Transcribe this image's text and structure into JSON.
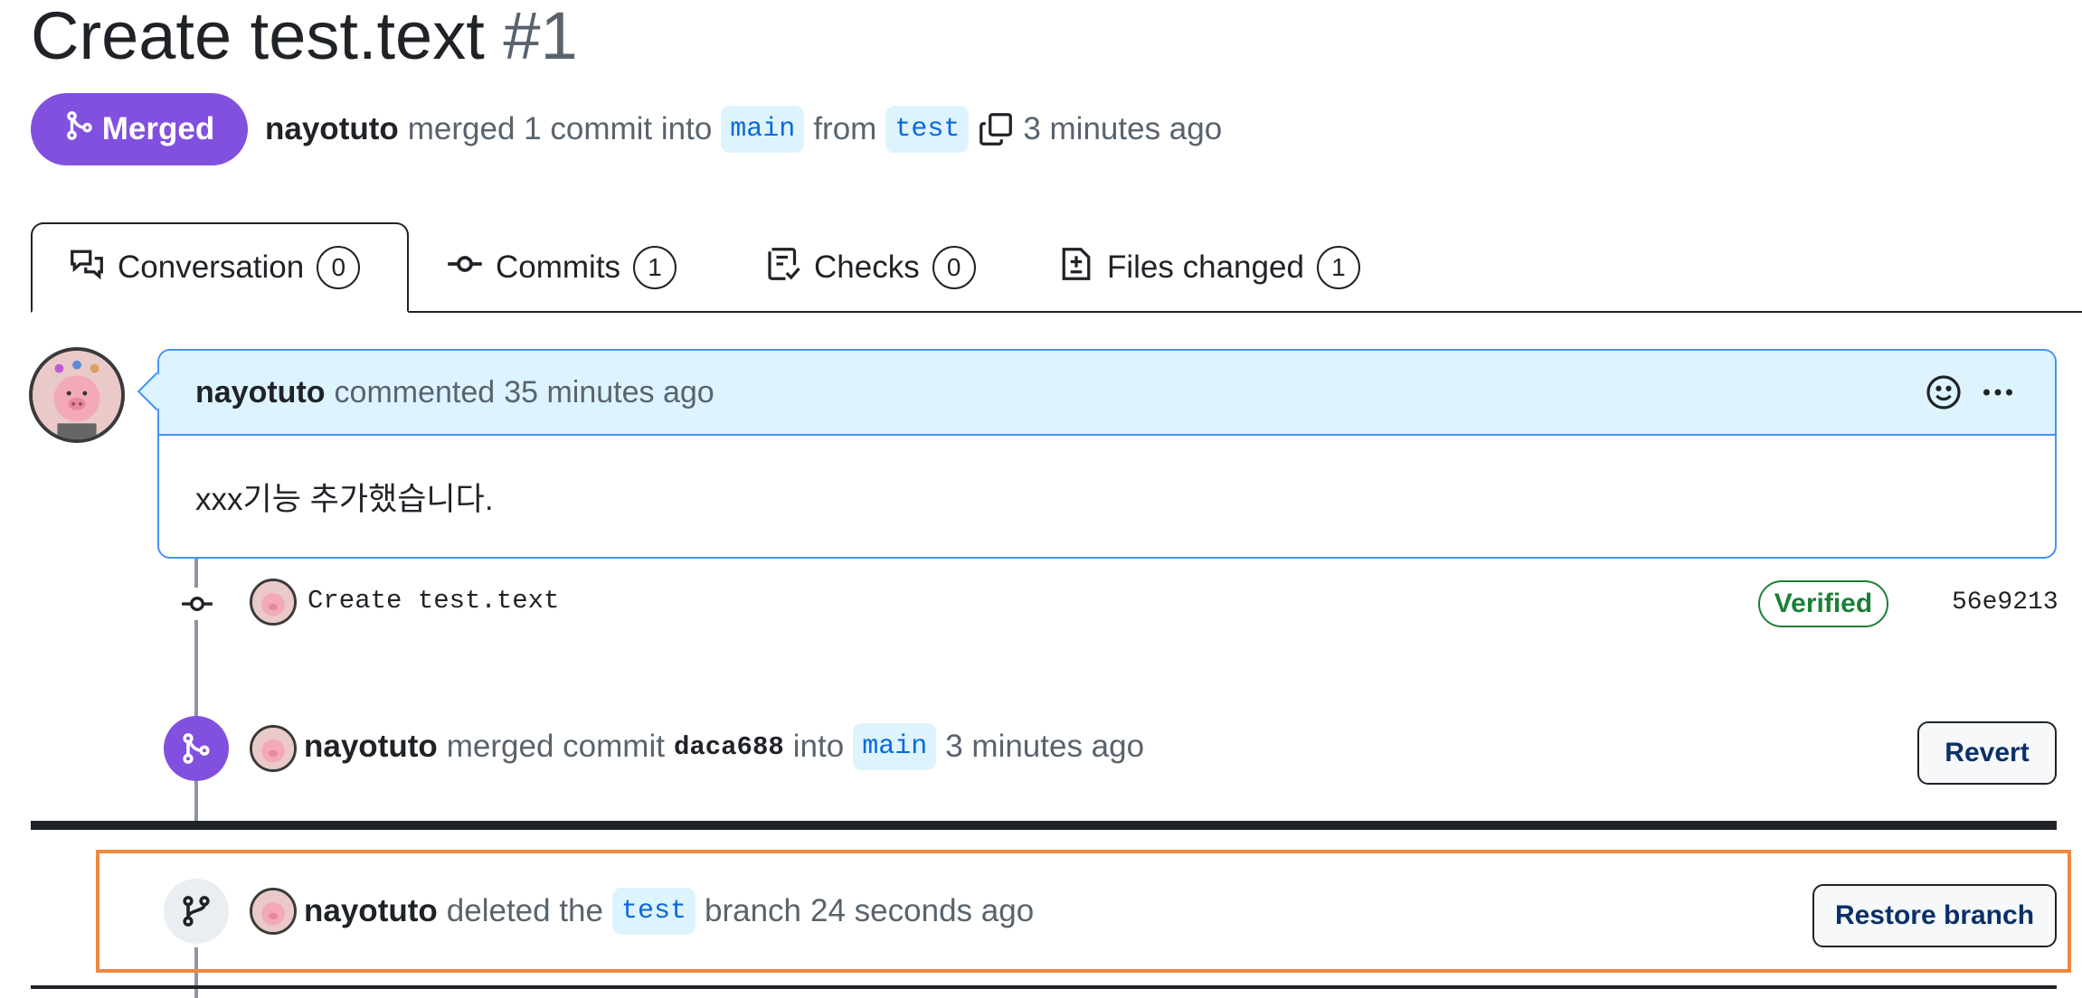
{
  "pr": {
    "title": "Create test.text",
    "number": "#1",
    "state": "Merged",
    "meta": {
      "author": "nayotuto",
      "action": "merged 1 commit into",
      "base_branch": "main",
      "from": "from",
      "head_branch": "test",
      "time": "3 minutes ago"
    }
  },
  "tabs": [
    {
      "label": "Conversation",
      "count": "0",
      "icon": "comment-discussion-icon"
    },
    {
      "label": "Commits",
      "count": "1",
      "icon": "git-commit-icon"
    },
    {
      "label": "Checks",
      "count": "0",
      "icon": "checklist-icon"
    },
    {
      "label": "Files changed",
      "count": "1",
      "icon": "file-diff-icon"
    }
  ],
  "comment": {
    "author": "nayotuto",
    "action": "commented",
    "time": "35 minutes ago",
    "body": "xxx기능 추가했습니다."
  },
  "commit": {
    "message": "Create test.text",
    "badge": "Verified",
    "sha": "56e9213"
  },
  "merge_event": {
    "author": "nayotuto",
    "action": "merged commit",
    "sha": "daca688",
    "into": "into",
    "branch": "main",
    "time": "3 minutes ago",
    "button": "Revert"
  },
  "delete_event": {
    "author": "nayotuto",
    "action": "deleted the",
    "branch": "test",
    "suffix": "branch",
    "time": "24 seconds ago",
    "button": "Restore branch"
  },
  "colors": {
    "merged": "#8250df",
    "accent_blue": "#0969da",
    "verified_green": "#1a7f37",
    "highlight_orange": "#f0883e"
  }
}
